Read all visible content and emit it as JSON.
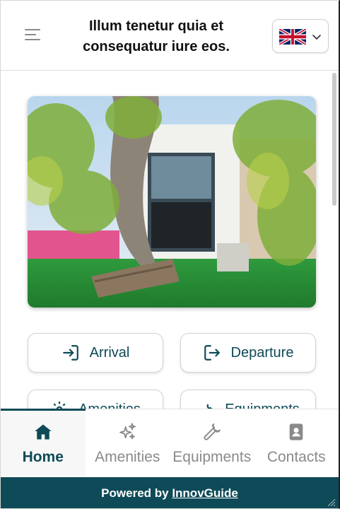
{
  "header": {
    "title": "Illum tenetur quia et consequatur iure eos.",
    "language": "English (UK)"
  },
  "actions": [
    {
      "label": "Arrival",
      "icon": "sign-in-icon"
    },
    {
      "label": "Departure",
      "icon": "sign-out-icon"
    },
    {
      "label": "Amenities",
      "icon": "gear-icon"
    },
    {
      "label": "Equipments",
      "icon": "wrench-icon"
    }
  ],
  "tabs": [
    {
      "label": "Home",
      "icon": "home-icon",
      "active": true
    },
    {
      "label": "Amenities",
      "icon": "sparkles-icon",
      "active": false
    },
    {
      "label": "Equipments",
      "icon": "wrench-icon",
      "active": false
    },
    {
      "label": "Contacts",
      "icon": "contact-book-icon",
      "active": false
    }
  ],
  "footer": {
    "prefix": "Powered by ",
    "brand": "InnovGuide"
  },
  "colors": {
    "accent": "#0e4a57",
    "inactive": "#8a8a8a"
  }
}
